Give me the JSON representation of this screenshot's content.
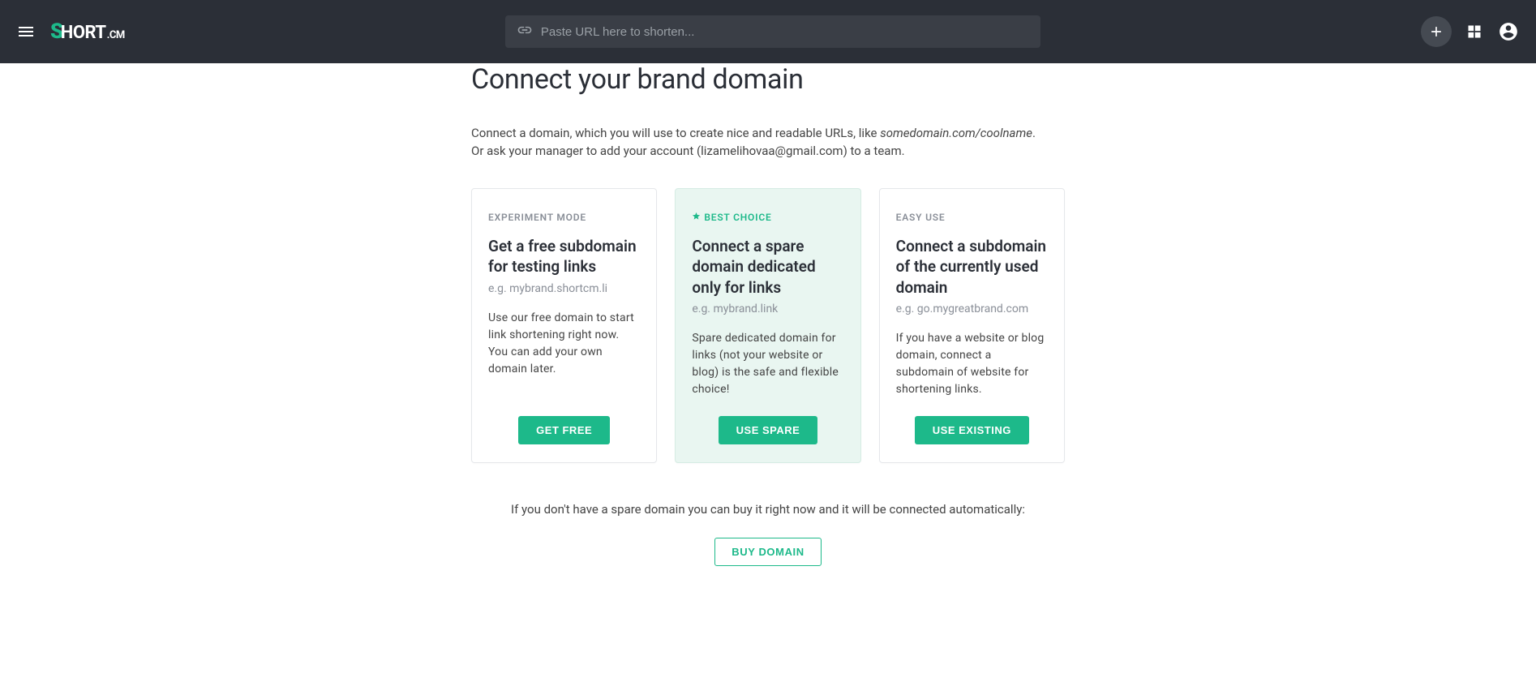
{
  "header": {
    "logo_accent": "S",
    "logo_text": "HORT",
    "logo_suffix": ".CM",
    "search_placeholder": "Paste URL here to shorten..."
  },
  "page": {
    "title": "Connect your brand domain",
    "intro_part1": "Connect a domain, which you will use to create nice and readable URLs, like ",
    "intro_example": "somedomain.com/coolname",
    "intro_part2": ".",
    "intro_line2": "Or ask your manager to add your account (lizamelihovaa@gmail.com) to a team."
  },
  "cards": [
    {
      "label": "EXPERIMENT MODE",
      "title": "Get a free subdomain for testing links",
      "example": "e.g. mybrand.shortcm.li",
      "desc": "Use our free domain to start link shortening right now. You can add your own domain later.",
      "button": "GET FREE"
    },
    {
      "label": "BEST CHOICE",
      "title": "Connect a spare domain dedicated only for links",
      "example": "e.g. mybrand.link",
      "desc": "Spare dedicated domain for links (not your website or blog) is the safe and flexible choice!",
      "button": "USE SPARE"
    },
    {
      "label": "EASY USE",
      "title": "Connect a subdomain of the currently used domain",
      "example": "e.g. go.mygreatbrand.com",
      "desc": "If you have a website or blog domain, connect a subdomain of website for shortening links.",
      "button": "USE EXISTING"
    }
  ],
  "buy": {
    "text": "If you don't have a spare domain you can buy it right now and it will be connected automatically:",
    "button": "BUY DOMAIN"
  }
}
